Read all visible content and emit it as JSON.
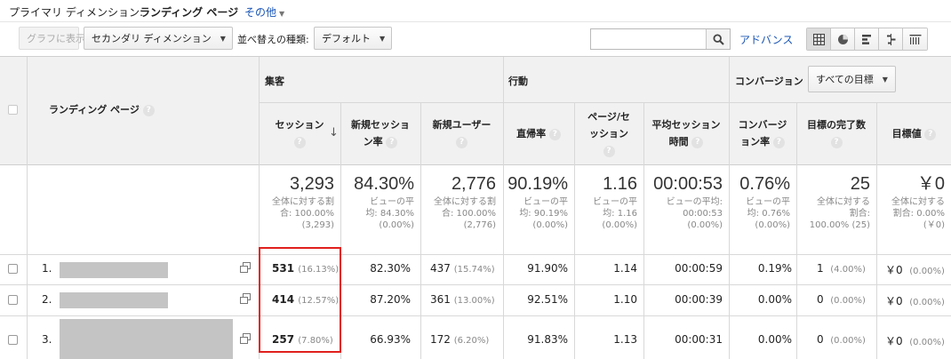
{
  "dimension_bar": {
    "label": "プライマリ ディメンション:",
    "value": "ランディング ページ",
    "other": "その他"
  },
  "toolbar": {
    "graph_button": "グラフに表示",
    "secondary_dimension": "セカンダリ ディメンション",
    "sort_label": "並べ替えの種類:",
    "sort_value": "デフォルト",
    "search_value": "",
    "advanced": "アドバンス",
    "view_icons": [
      "table-icon",
      "pie-icon",
      "performance-icon",
      "comparison-icon",
      "term-cloud-icon"
    ]
  },
  "table": {
    "dim_header": "ランディング ページ",
    "group_acquisition": "集客",
    "group_behavior": "行動",
    "group_conversion": "コンバージョン",
    "goal_select": "すべての目標",
    "columns": [
      {
        "line1": "セッション",
        "line2": ""
      },
      {
        "line1": "新規セッショ",
        "line2": "ン率"
      },
      {
        "line1": "新規ユーザー",
        "line2": ""
      },
      {
        "line1": "直帰率",
        "line2": ""
      },
      {
        "line1": "ページ/セ",
        "line2": "ッション"
      },
      {
        "line1": "平均セッション",
        "line2": "時間"
      },
      {
        "line1": "コンバージ",
        "line2": "ョン率"
      },
      {
        "line1": "目標の完了数",
        "line2": ""
      },
      {
        "line1": "目標値",
        "line2": ""
      }
    ],
    "totals": [
      {
        "value": "3,293",
        "sub": [
          "全体に対する割",
          "合: 100.00%",
          "(3,293)"
        ]
      },
      {
        "value": "84.30%",
        "sub": [
          "ビューの平",
          "均: 84.30%",
          "(0.00%)"
        ]
      },
      {
        "value": "2,776",
        "sub": [
          "全体に対する割",
          "合: 100.00%",
          "(2,776)"
        ]
      },
      {
        "value": "90.19%",
        "sub": [
          "ビューの平",
          "均: 90.19%",
          "(0.00%)"
        ]
      },
      {
        "value": "1.16",
        "sub": [
          "ビューの平",
          "均: 1.16",
          "(0.00%)"
        ]
      },
      {
        "value": "00:00:53",
        "sub": [
          "ビューの平均:",
          "00:00:53",
          "(0.00%)"
        ]
      },
      {
        "value": "0.76%",
        "sub": [
          "ビューの平",
          "均: 0.76%",
          "(0.00%)"
        ]
      },
      {
        "value": "25",
        "sub": [
          "全体に対する",
          "割合:",
          "100.00% (25)"
        ]
      },
      {
        "value": "￥0",
        "sub": [
          "全体に対する",
          "割合: 0.00%",
          "(￥0)"
        ]
      }
    ],
    "rows": [
      {
        "index": "1.",
        "sessions": "531",
        "sessions_pct": "(16.13%)",
        "new_rate": "82.30%",
        "new_users": "437",
        "new_users_pct": "(15.74%)",
        "bounce": "91.90%",
        "pages": "1.14",
        "duration": "00:00:59",
        "conv": "0.19%",
        "goals": "1",
        "goals_pct": "(4.00%)",
        "goal_value": "￥0",
        "goal_value_pct": "(0.00%)"
      },
      {
        "index": "2.",
        "sessions": "414",
        "sessions_pct": "(12.57%)",
        "new_rate": "87.20%",
        "new_users": "361",
        "new_users_pct": "(13.00%)",
        "bounce": "92.51%",
        "pages": "1.10",
        "duration": "00:00:39",
        "conv": "0.00%",
        "goals": "0",
        "goals_pct": "(0.00%)",
        "goal_value": "￥0",
        "goal_value_pct": "(0.00%)"
      },
      {
        "index": "3.",
        "sessions": "257",
        "sessions_pct": "(7.80%)",
        "new_rate": "66.93%",
        "new_users": "172",
        "new_users_pct": "(6.20%)",
        "bounce": "91.83%",
        "pages": "1.13",
        "duration": "00:00:31",
        "conv": "0.00%",
        "goals": "0",
        "goals_pct": "(0.00%)",
        "goal_value": "￥0",
        "goal_value_pct": "(0.00%)"
      }
    ]
  },
  "colors": {
    "link": "#1a55b5",
    "highlight": "#e0201d",
    "header_bg": "#f1f1f1"
  }
}
